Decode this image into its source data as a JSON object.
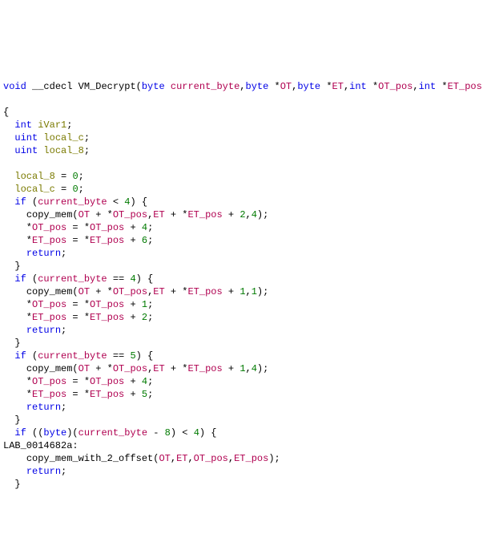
{
  "fn_sig": {
    "ret": "void",
    "cc": "__cdecl",
    "name": "VM_Decrypt",
    "params": [
      {
        "type": "byte",
        "name": "current_byte"
      },
      {
        "type": "byte",
        "ptr": "*",
        "name": "OT"
      },
      {
        "type": "byte",
        "ptr": "*",
        "name": "ET"
      },
      {
        "type": "int",
        "ptr": "*",
        "name": "OT_pos"
      },
      {
        "type": "int",
        "ptr": "*",
        "name": "ET_pos"
      }
    ]
  },
  "locals": [
    {
      "type": "int",
      "name": "iVar1"
    },
    {
      "type": "uint",
      "name": "local_c"
    },
    {
      "type": "uint",
      "name": "local_8"
    }
  ],
  "body": {
    "init1_lhs": "local_8",
    "init1_eq": " = ",
    "init1_rhs": "0",
    "init2_lhs": "local_c",
    "init2_eq": " = ",
    "init2_rhs": "0",
    "if1_kw": "if",
    "if1_p": "current_byte",
    "if1_op": " < ",
    "if1_n": "4",
    "if1_call": "copy_mem",
    "if1_a1": "OT",
    "if1_a2": "OT_pos",
    "if1_a3": "ET",
    "if1_a4": "ET_pos",
    "if1_off": "2",
    "if1_len": "4",
    "if1_s1_l": "OT_pos",
    "if1_s1_r": "OT_pos",
    "if1_s1_n": "4",
    "if1_s2_l": "ET_pos",
    "if1_s2_r": "ET_pos",
    "if1_s2_n": "6",
    "ret": "return",
    "if2_kw": "if",
    "if2_p": "current_byte",
    "if2_op": " == ",
    "if2_n": "4",
    "if2_call": "copy_mem",
    "if2_a1": "OT",
    "if2_a2": "OT_pos",
    "if2_a3": "ET",
    "if2_a4": "ET_pos",
    "if2_off": "1",
    "if2_len": "1",
    "if2_s1_l": "OT_pos",
    "if2_s1_r": "OT_pos",
    "if2_s1_n": "1",
    "if2_s2_l": "ET_pos",
    "if2_s2_r": "ET_pos",
    "if2_s2_n": "2",
    "if3_kw": "if",
    "if3_p": "current_byte",
    "if3_op": " == ",
    "if3_n": "5",
    "if3_call": "copy_mem",
    "if3_a1": "OT",
    "if3_a2": "OT_pos",
    "if3_a3": "ET",
    "if3_a4": "ET_pos",
    "if3_off": "1",
    "if3_len": "4",
    "if3_s1_l": "OT_pos",
    "if3_s1_r": "OT_pos",
    "if3_s1_n": "4",
    "if3_s2_l": "ET_pos",
    "if3_s2_r": "ET_pos",
    "if3_s2_n": "5",
    "if4_kw": "if",
    "if4_cast": "byte",
    "if4_p": "current_byte",
    "if4_sub": "8",
    "if4_op": " < ",
    "if4_n": "4",
    "label": "LAB_0014682a",
    "if4_call": "copy_mem_with_2_offset",
    "if4_a1": "OT",
    "if4_a2": "ET",
    "if4_a3": "OT_pos",
    "if4_a4": "ET_pos"
  }
}
